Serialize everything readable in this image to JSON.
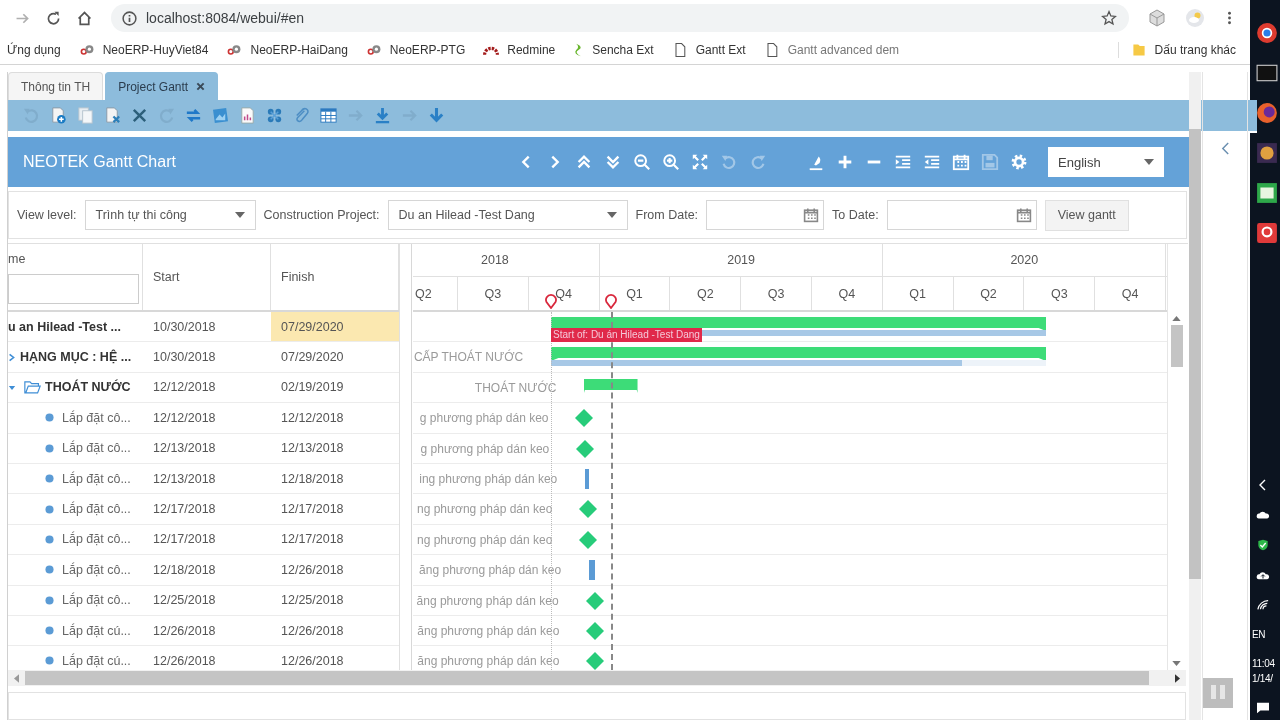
{
  "browser": {
    "address": "localhost:8084/webui/#en",
    "bookmarks": [
      {
        "label": "Ứng dụng",
        "kind": "plain"
      },
      {
        "label": "NeoERP-HuyViet84",
        "kind": "gear"
      },
      {
        "label": "NeoERP-HaiDang",
        "kind": "gear"
      },
      {
        "label": "NeoERP-PTG",
        "kind": "gear"
      },
      {
        "label": "Redmine",
        "kind": "arc"
      },
      {
        "label": "Sencha Ext",
        "kind": "leaf"
      },
      {
        "label": "Gantt Ext",
        "kind": "page"
      },
      {
        "label": "Gantt advanced dem",
        "kind": "page"
      }
    ],
    "other_bookmarks": "Dấu trang khác"
  },
  "tabs": [
    {
      "label": "Thông tin TH",
      "selected": false,
      "closable": false
    },
    {
      "label": "Project Gantt",
      "selected": true,
      "closable": true
    }
  ],
  "toolbar": [
    {
      "kind": "undo",
      "disabled": true
    },
    {
      "kind": "new",
      "disabled": false
    },
    {
      "kind": "copy",
      "disabled": false
    },
    {
      "kind": "edit",
      "disabled": false
    },
    {
      "kind": "delete",
      "disabled": false
    },
    {
      "kind": "redo",
      "disabled": true
    },
    {
      "kind": "sync",
      "disabled": false
    },
    {
      "kind": "image",
      "disabled": false
    },
    {
      "kind": "report",
      "disabled": false
    },
    {
      "kind": "network",
      "disabled": false
    },
    {
      "kind": "attach",
      "disabled": false
    },
    {
      "kind": "table",
      "disabled": false
    },
    {
      "kind": "forward",
      "disabled": true
    },
    {
      "kind": "download",
      "disabled": false
    },
    {
      "kind": "forward",
      "disabled": true
    },
    {
      "kind": "arrowdown",
      "disabled": false
    }
  ],
  "header": {
    "title": "NEOTEK Gantt Chart",
    "nav_tools": [
      {
        "kind": "prev",
        "disabled": false
      },
      {
        "kind": "next",
        "disabled": false
      },
      {
        "kind": "collapse",
        "disabled": false
      },
      {
        "kind": "expand",
        "disabled": false
      },
      {
        "kind": "zoomout",
        "disabled": false
      },
      {
        "kind": "zoomin",
        "disabled": false
      },
      {
        "kind": "fit",
        "disabled": false
      },
      {
        "kind": "undo",
        "disabled": true
      },
      {
        "kind": "redo",
        "disabled": true
      }
    ],
    "edit_tools": [
      {
        "kind": "pen",
        "disabled": false
      },
      {
        "kind": "plus",
        "disabled": false
      },
      {
        "kind": "minus",
        "disabled": false
      },
      {
        "kind": "indent",
        "disabled": false
      },
      {
        "kind": "outdent",
        "disabled": false
      },
      {
        "kind": "calendar",
        "disabled": false
      },
      {
        "kind": "save",
        "disabled": true
      },
      {
        "kind": "gear",
        "disabled": false
      }
    ],
    "language": "English"
  },
  "filters": {
    "view_level_label": "View level:",
    "view_level": "Trình tự thi công",
    "project_label": "Construction Project:",
    "project": "Du an Hilead -Test Dang",
    "from_label": "From Date:",
    "to_label": "To Date:",
    "button": "View gantt"
  },
  "grid": {
    "columns": [
      {
        "label": "me",
        "filter": true
      },
      {
        "label": "Start"
      },
      {
        "label": "Finish"
      }
    ],
    "rows": [
      {
        "name": "u an Hilead -Test ...",
        "start": "10/30/2018",
        "finish": "07/29/2020",
        "kind": "project",
        "selected": true,
        "level": 1
      },
      {
        "name": "HẠNG MỤC : HỆ ...",
        "start": "10/30/2018",
        "finish": "07/29/2020",
        "kind": "group",
        "selected": false,
        "level": 0.83,
        "bar_label": "CẤP THOÁT NƯỚC"
      },
      {
        "name": "THOÁT NƯỚC",
        "start": "12/12/2018",
        "finish": "02/19/2019",
        "kind": "folder",
        "selected": false,
        "bar_label": "THOÁT NƯỚC"
      },
      {
        "name": "Lắp đặt cô...",
        "start": "12/12/2018",
        "finish": "12/12/2018",
        "kind": "task",
        "selected": false,
        "bar_label": "g phương pháp dán keo"
      },
      {
        "name": "Lắp đặt cô...",
        "start": "12/13/2018",
        "finish": "12/13/2018",
        "kind": "task",
        "selected": false,
        "bar_label": "g phương pháp dán keo"
      },
      {
        "name": "Lắp đặt cô...",
        "start": "12/13/2018",
        "finish": "12/18/2018",
        "kind": "task",
        "selected": false,
        "bar_label": "ing phương pháp dán keo"
      },
      {
        "name": "Lắp đặt cô...",
        "start": "12/17/2018",
        "finish": "12/17/2018",
        "kind": "task",
        "selected": false,
        "bar_label": "ng phương pháp dán keo"
      },
      {
        "name": "Lắp đặt cô...",
        "start": "12/17/2018",
        "finish": "12/17/2018",
        "kind": "task",
        "selected": false,
        "bar_label": "ng phương pháp dán keo"
      },
      {
        "name": "Lắp đặt cô...",
        "start": "12/18/2018",
        "finish": "12/26/2018",
        "kind": "task",
        "selected": false,
        "bar_label": "ăng phương pháp dán keo"
      },
      {
        "name": "Lắp đặt cô...",
        "start": "12/25/2018",
        "finish": "12/25/2018",
        "kind": "task",
        "selected": false,
        "bar_label": "ăng phương pháp dán keo"
      },
      {
        "name": "Lắp đặt cú...",
        "start": "12/26/2018",
        "finish": "12/26/2018",
        "kind": "task",
        "selected": false,
        "bar_label": "ăng phương pháp dán keo"
      },
      {
        "name": "Lắp đặt cú...",
        "start": "12/26/2018",
        "finish": "12/26/2018",
        "kind": "task",
        "selected": false,
        "bar_label": "ăng phương pháp dán keo"
      }
    ]
  },
  "timeline": {
    "years": [
      "2018",
      "2019",
      "2020"
    ],
    "quarters": [
      "Q2",
      "Q3",
      "Q4",
      "Q1",
      "Q2",
      "Q3",
      "Q4",
      "Q1",
      "Q2",
      "Q3",
      "Q4"
    ],
    "start_marker": "Start of: Du án Hilead -Test Dang"
  },
  "taskbar": {
    "language": "EN",
    "time": "11:04",
    "date": "1/14/"
  }
}
